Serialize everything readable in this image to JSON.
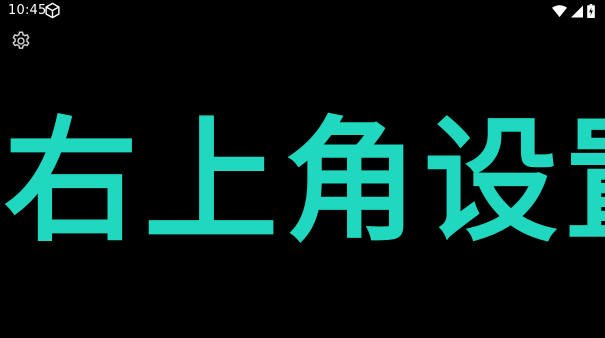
{
  "status_bar": {
    "time": "10:45",
    "icons": [
      "cube-icon",
      "wifi-icon",
      "signal-icon",
      "battery-charging-icon"
    ]
  },
  "toolbar": {
    "settings_icon": "gear-icon"
  },
  "main": {
    "display_text": "右上角设置"
  },
  "colors": {
    "background": "#000000",
    "text_accent": "#1fd8bf",
    "icon": "#ffffff",
    "gear_icon": "#cfcfcf"
  }
}
